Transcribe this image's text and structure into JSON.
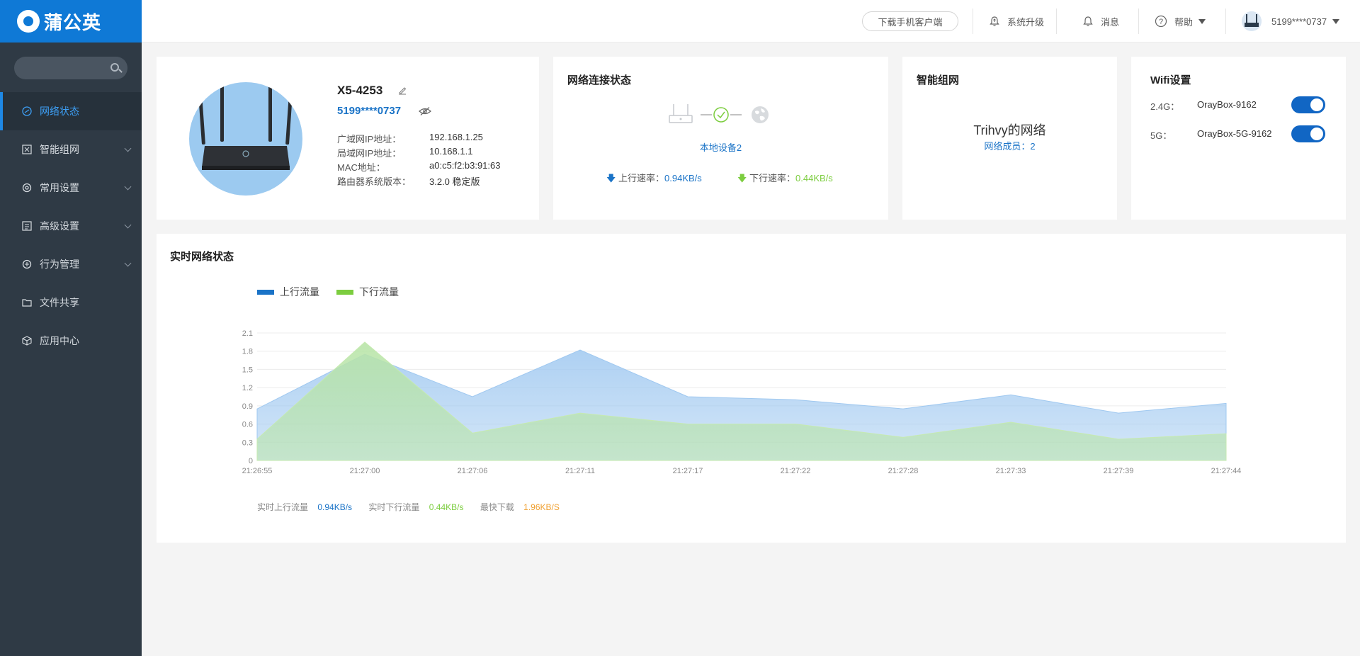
{
  "brand": {
    "name": "蒲公英"
  },
  "sidebar": {
    "search_placeholder": "",
    "items": [
      {
        "label": "网络状态",
        "icon": "network-status-icon",
        "active": true,
        "expandable": false
      },
      {
        "label": "智能组网",
        "icon": "smart-network-icon",
        "active": false,
        "expandable": true
      },
      {
        "label": "常用设置",
        "icon": "gear-icon",
        "active": false,
        "expandable": true
      },
      {
        "label": "高级设置",
        "icon": "advanced-settings-icon",
        "active": false,
        "expandable": true
      },
      {
        "label": "行为管理",
        "icon": "behavior-icon",
        "active": false,
        "expandable": true
      },
      {
        "label": "文件共享",
        "icon": "folder-icon",
        "active": false,
        "expandable": false
      },
      {
        "label": "应用中心",
        "icon": "cube-icon",
        "active": false,
        "expandable": false
      }
    ]
  },
  "topbar": {
    "download_label": "下载手机客户端",
    "upgrade_label": "系统升级",
    "messages_label": "消息",
    "help_label": "帮助",
    "user_label": "5199****0737"
  },
  "device": {
    "name": "X5-4253",
    "account": "5199****0737",
    "rows": [
      {
        "label": "广域网IP地址：",
        "value": "192.168.1.25"
      },
      {
        "label": "局域网IP地址：",
        "value": "10.168.1.1"
      },
      {
        "label": "MAC地址：",
        "value": "a0:c5:f2:b3:91:63"
      },
      {
        "label": "路由器系统版本：",
        "value": "3.2.0 稳定版"
      }
    ]
  },
  "connection": {
    "title": "网络连接状态",
    "local_devices": "本地设备2",
    "up_label": "上行速率：",
    "up_value": "0.94KB/s",
    "down_label": "下行速率：",
    "down_value": "0.44KB/s"
  },
  "smart_net": {
    "title": "智能组网",
    "network_name": "Trihvy的网络",
    "members": "网络成员：2"
  },
  "wifi": {
    "title": "Wifi设置",
    "bands": [
      {
        "band": "2.4G：",
        "ssid": "OrayBox-9162",
        "enabled": true
      },
      {
        "band": "5G：",
        "ssid": "OrayBox-5G-9162",
        "enabled": true
      }
    ]
  },
  "realtime": {
    "title": "实时网络状态",
    "footer": {
      "up_label": "实时上行流量",
      "up_value": "0.94KB/s",
      "down_label": "实时下行流量",
      "down_value": "0.44KB/s",
      "max_label": "最快下载",
      "max_value": "1.96KB/S"
    }
  },
  "colors": {
    "primary": "#0f79d6",
    "up": "#1a73c7",
    "down": "#7ccd3f",
    "max": "#f0a030",
    "up_fill": "#9fc8f0",
    "down_fill": "#b8e4a8"
  },
  "chart_data": {
    "type": "area",
    "x": [
      "21:26:55",
      "21:27:00",
      "21:27:06",
      "21:27:11",
      "21:27:17",
      "21:27:22",
      "21:27:28",
      "21:27:33",
      "21:27:39",
      "21:27:44"
    ],
    "series": [
      {
        "name": "上行流量",
        "values": [
          0.85,
          1.75,
          1.05,
          1.82,
          1.05,
          1.0,
          0.85,
          1.08,
          0.78,
          0.94
        ]
      },
      {
        "name": "下行流量",
        "values": [
          0.35,
          1.95,
          0.45,
          0.78,
          0.6,
          0.6,
          0.38,
          0.63,
          0.35,
          0.44
        ]
      }
    ],
    "yticks": [
      0,
      0.3,
      0.6,
      0.9,
      1.2,
      1.5,
      1.8,
      2.1
    ],
    "ylim": [
      0,
      2.1
    ],
    "grid": true,
    "legend": "top-left"
  }
}
